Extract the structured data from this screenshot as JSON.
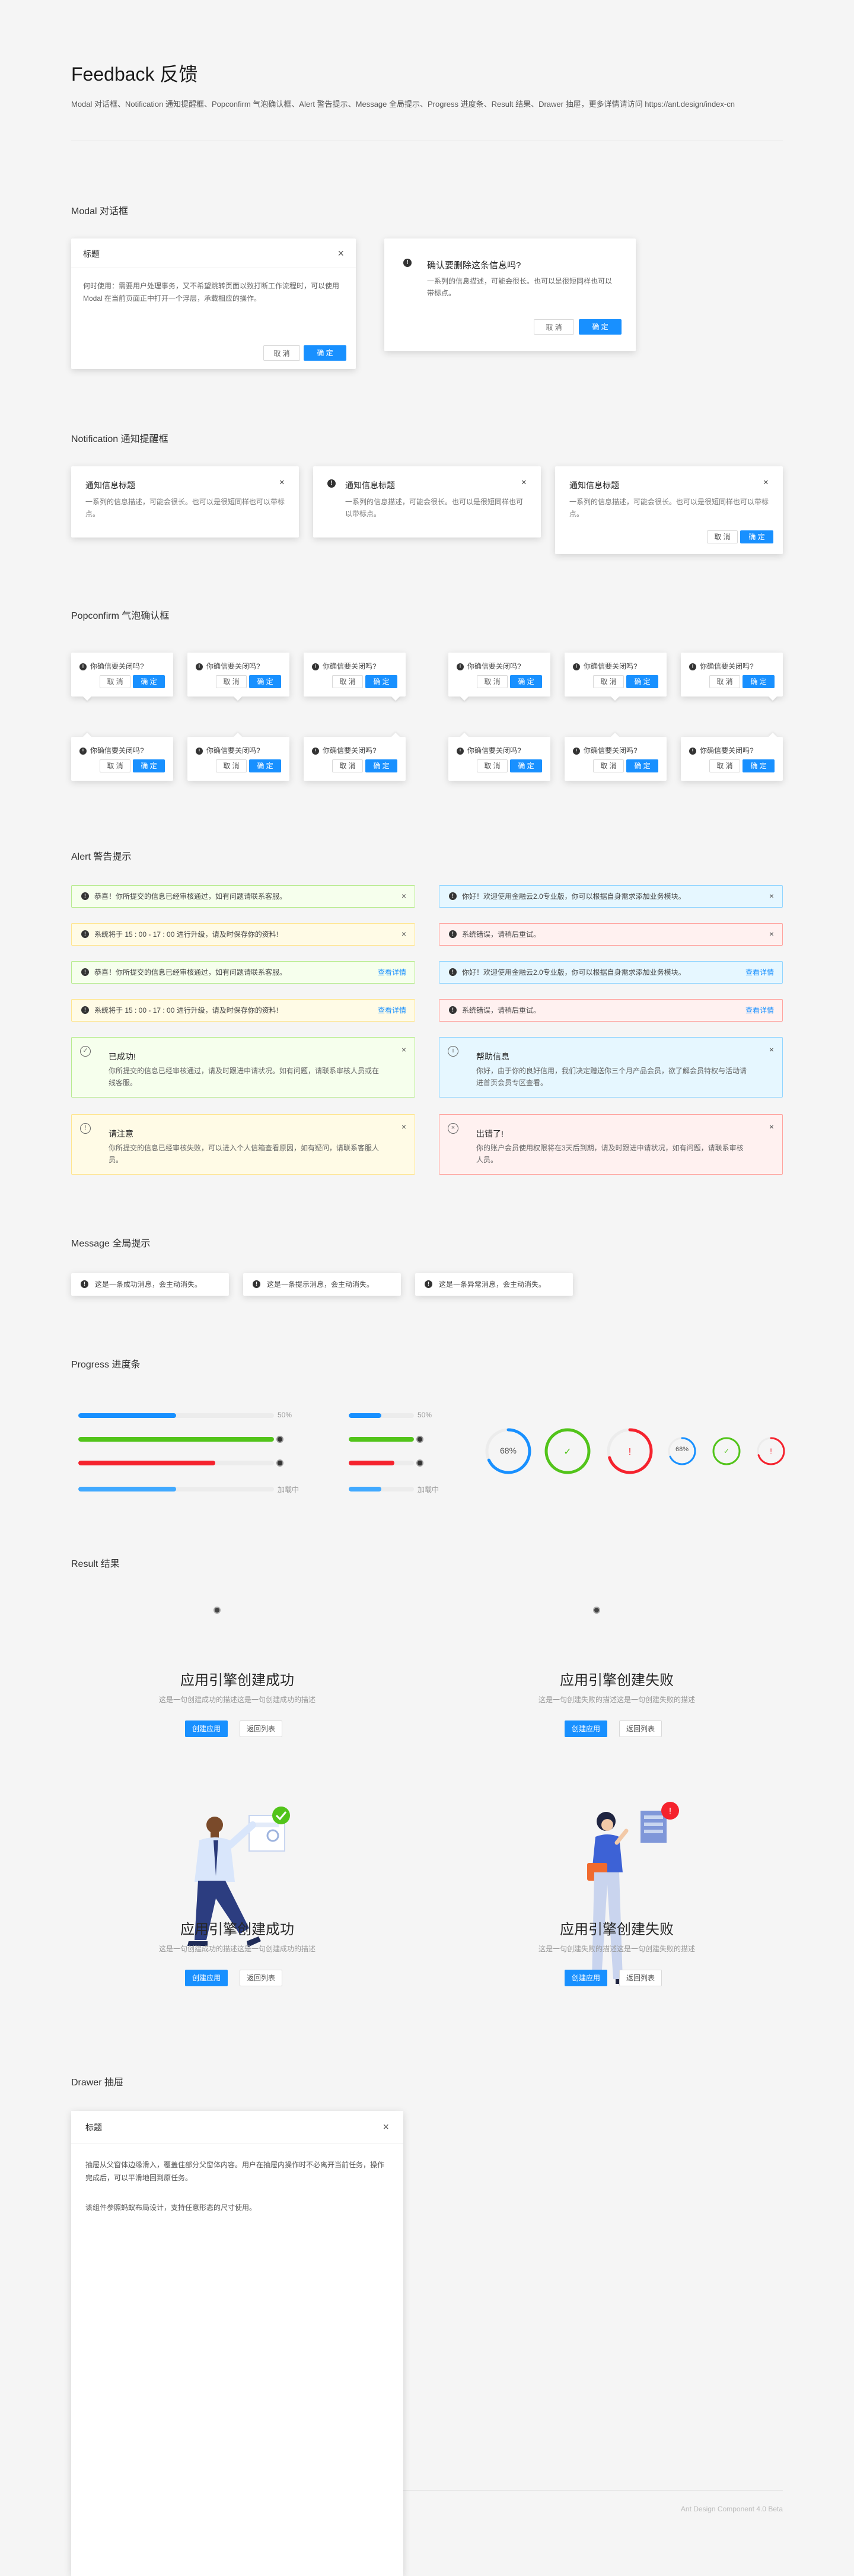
{
  "page": {
    "title": "Feedback 反馈",
    "subtitle": "Modal 对话框、Notification 通知提醒框、Popconfirm 气泡确认框、Alert 警告提示、Message 全局提示、Progress 进度条、Result 结果、Drawer 抽屉，更多详情请访问 https://ant.design/index-cn",
    "footer": "Ant Design Component 4.0 Beta"
  },
  "modal": {
    "section": "Modal 对话框",
    "basic": {
      "title": "标题",
      "body": "何时使用：需要用户处理事务，又不希望跳转页面以致打断工作流程时，可以使用 Modal 在当前页面正中打开一个浮层，承载相应的操作。",
      "cancel": "取 消",
      "ok": "确 定"
    },
    "confirm": {
      "title": "确认要删除这条信息吗?",
      "body": "一系列的信息描述，可能会很长。也可以是很短同样也可以带标点。",
      "cancel": "取 消",
      "ok": "确 定"
    }
  },
  "notification": {
    "section": "Notification 通知提醒框",
    "items": [
      {
        "title": "通知信息标题",
        "desc": "一系列的信息描述，可能会很长。也可以是很短同样也可以带标点。"
      },
      {
        "title": "通知信息标题",
        "desc": "一系列的信息描述，可能会很长。也可以是很短同样也可以带标点。"
      },
      {
        "title": "通知信息标题",
        "desc": "一系列的信息描述，可能会很长。也可以是很短同样也可以带标点。",
        "cancel": "取 消",
        "ok": "确 定"
      }
    ]
  },
  "popconfirm": {
    "section": "Popconfirm 气泡确认框",
    "text": "你确信要关闭吗?",
    "cancel": "取 消",
    "ok": "确 定"
  },
  "alert": {
    "section": "Alert 警告提示",
    "success": "恭喜！你所提交的信息已经审核通过，如有问题请联系客服。",
    "info": "你好！欢迎使用金融云2.0专业版，你可以根据自身需求添加业务模块。",
    "warning": "系统将于 15 : 00 - 17 : 00 进行升级，请及时保存你的资料!",
    "error": "系统错误，请稍后重试。",
    "link": "查看详情",
    "box_success": {
      "title": "已成功!",
      "desc": "你所提交的信息已经审核通过，请及时跟进申请状况。如有问题，请联系审核人员或在线客服。"
    },
    "box_info": {
      "title": "帮助信息",
      "desc": "你好，由于你的良好信用，我们决定赠送你三个月产品会员，欲了解会员特权与活动请进首页会员专区查看。"
    },
    "box_warning": {
      "title": "请注意",
      "desc": "你所提交的信息已经审核失败，可以进入个人信箱查看原因，如有疑问，请联系客服人员。"
    },
    "box_error": {
      "title": "出错了!",
      "desc": "你的账户会员使用权限将在3天后到期，请及时跟进申请状况，如有问题，请联系审核人员。"
    }
  },
  "message": {
    "section": "Message 全局提示",
    "items": [
      "这是一条成功消息，会主动消失。",
      "这是一条提示消息，会主动消失。",
      "这是一条异常消息，会主动消失。"
    ]
  },
  "progress": {
    "section": "Progress 进度条",
    "pct_label": "50%",
    "active_label": "加载中",
    "circle_label": "68%",
    "lines": [
      {
        "value": 50,
        "color": "#1890ff"
      },
      {
        "value": 100,
        "color": "#52c41a"
      },
      {
        "value": 70,
        "color": "#f5222d"
      },
      {
        "value": 50,
        "color": "#40a9ff"
      }
    ],
    "circles": [
      {
        "value": 68,
        "color": "#1890ff"
      },
      {
        "value": 100,
        "color": "#52c41a"
      },
      {
        "value": 70,
        "color": "#f5222d"
      }
    ]
  },
  "result": {
    "section": "Result 结果",
    "success": {
      "title": "应用引擎创建成功",
      "desc": "这是一句创建成功的描述这是一句创建成功的描述",
      "primary": "创建应用",
      "secondary": "返回列表"
    },
    "fail": {
      "title": "应用引擎创建失败",
      "desc": "这是一句创建失败的描述这是一句创建失败的描述",
      "primary": "创建应用",
      "secondary": "返回列表"
    }
  },
  "drawer": {
    "section": "Drawer 抽屉",
    "title": "标题",
    "p1": "抽屉从父窗体边缘滑入，覆盖住部分父窗体内容。用户在抽屉内操作时不必离开当前任务，操作完成后，可以平滑地回到原任务。",
    "p2": "该组件参照蚂蚁布局设计，支持任意形态的尺寸使用。"
  },
  "colors": {
    "primary": "#1890ff",
    "success": "#52c41a",
    "error": "#f5222d",
    "warning": "#faad14"
  }
}
